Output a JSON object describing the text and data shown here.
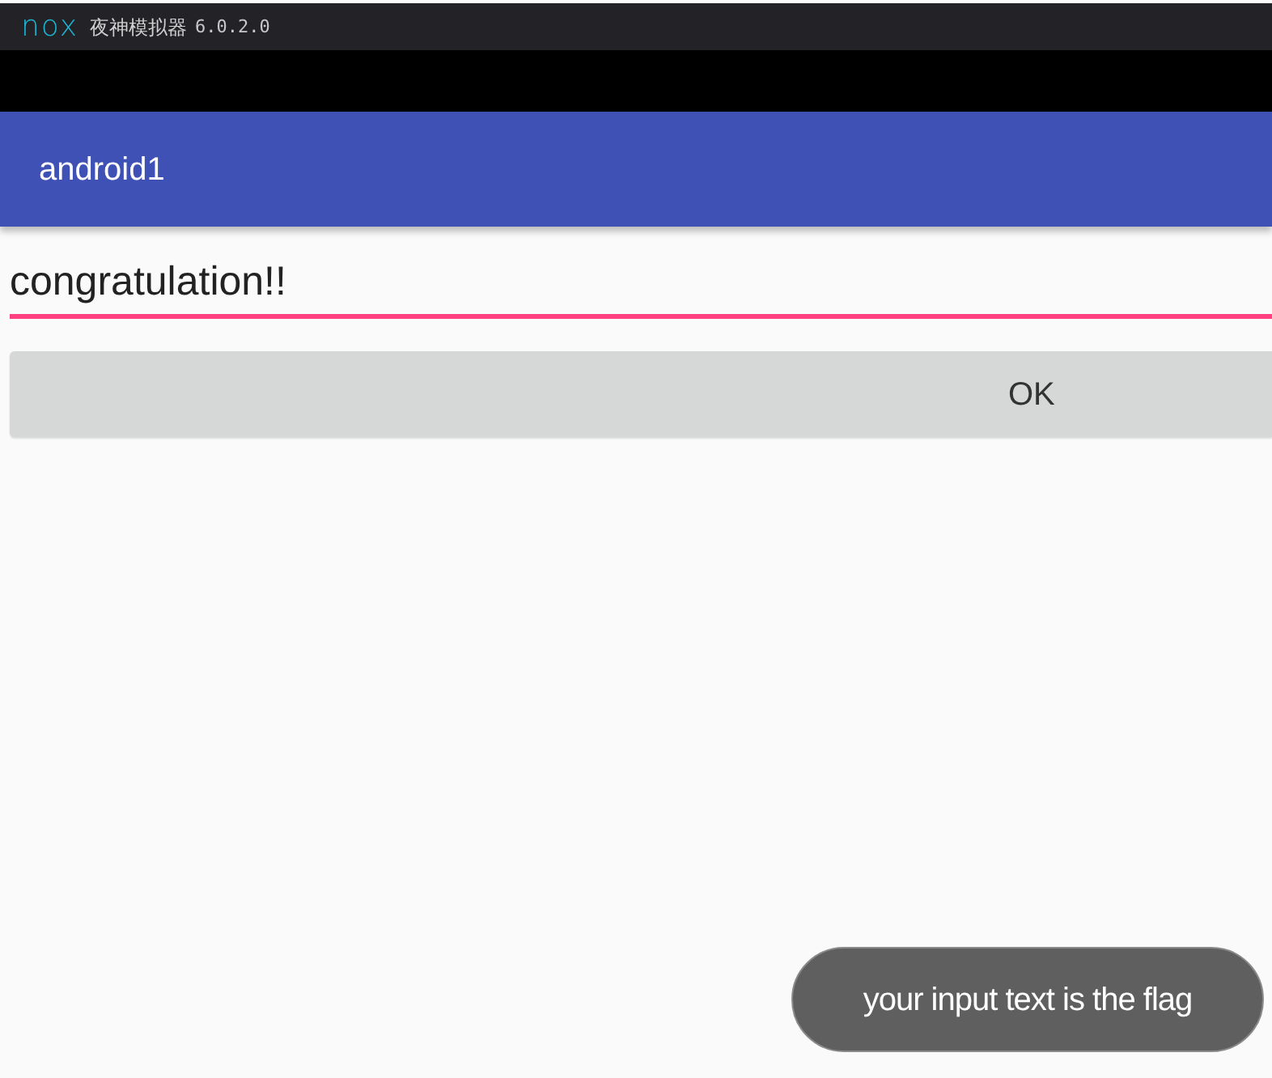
{
  "emulator_window": {
    "logo_text": "nox",
    "title": "夜神模拟器",
    "version": "6.0.2.0"
  },
  "app_bar": {
    "title": "android1"
  },
  "text_field": {
    "value": "congratulation!!",
    "focused": true
  },
  "button": {
    "label": "OK"
  },
  "toast": {
    "text": "your input text is the flag"
  }
}
